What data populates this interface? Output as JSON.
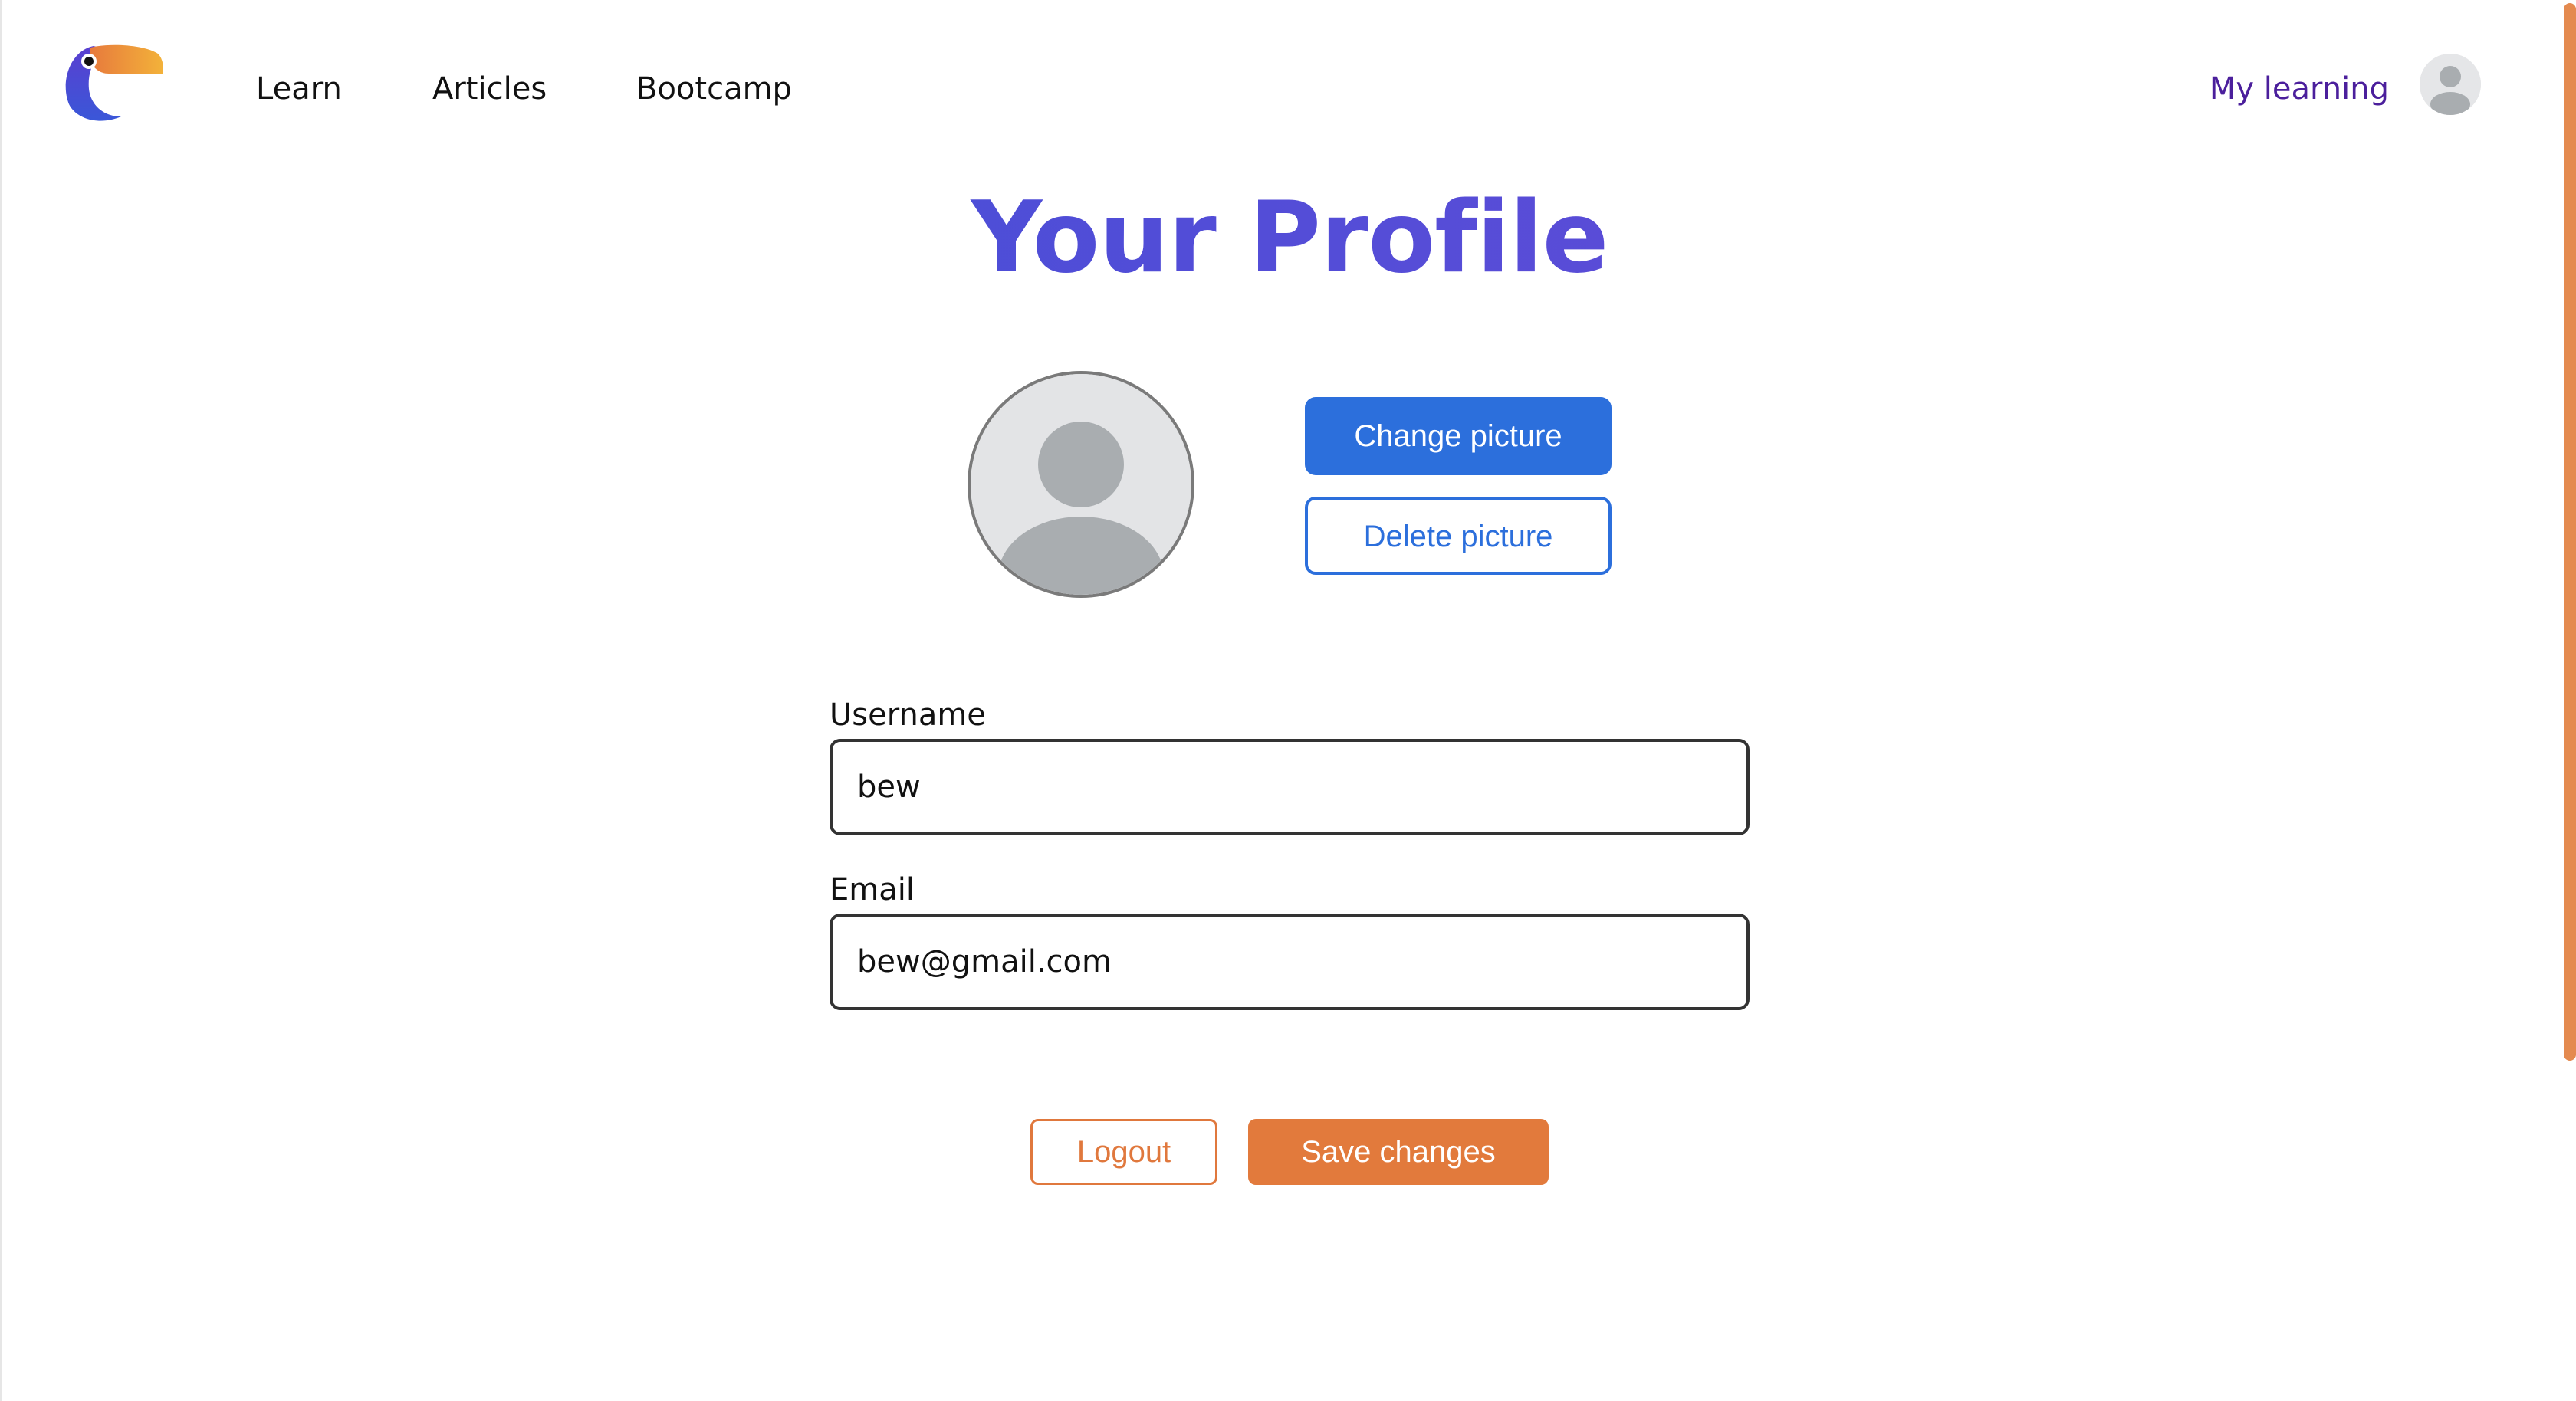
{
  "navbar": {
    "logo_icon": "toucan-logo-icon",
    "links": [
      {
        "label": "Learn"
      },
      {
        "label": "Articles"
      },
      {
        "label": "Bootcamp"
      }
    ],
    "my_learning": "My learning",
    "avatar_icon": "user-avatar-icon"
  },
  "page": {
    "title": "Your Profile"
  },
  "profile_picture": {
    "icon": "user-avatar-icon",
    "change_label": "Change picture",
    "delete_label": "Delete picture"
  },
  "form": {
    "username": {
      "label": "Username",
      "value": "bew"
    },
    "email": {
      "label": "Email",
      "value": "bew@gmail.com"
    }
  },
  "actions": {
    "logout_label": "Logout",
    "save_label": "Save changes"
  },
  "colors": {
    "title_gradient_start": "#3d4fd6",
    "title_gradient_end": "#6a4bd8",
    "primary_blue": "#2c6fdc",
    "accent_orange": "#e27a3c",
    "nav_accent_purple": "#4b1f9c"
  }
}
